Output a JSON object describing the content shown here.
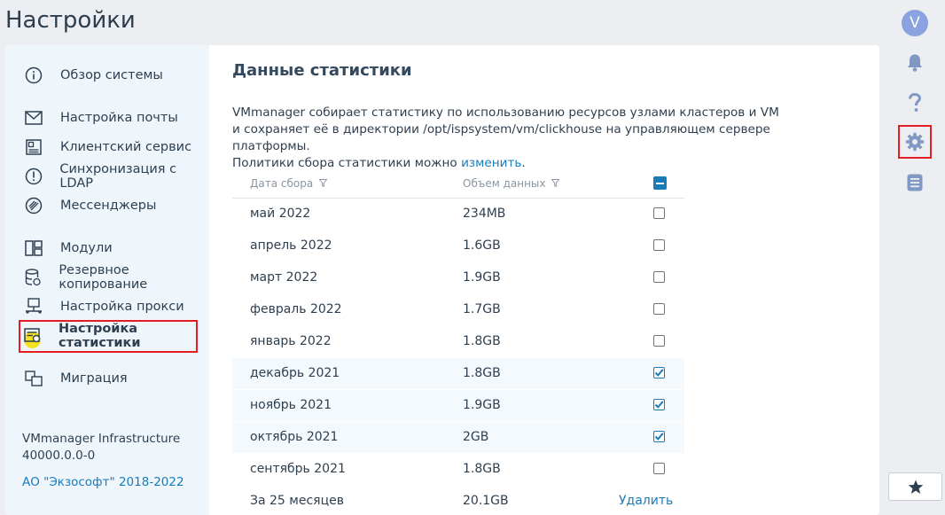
{
  "page": {
    "title": "Настройки"
  },
  "sidebar": {
    "items": [
      {
        "label": "Обзор системы"
      },
      {
        "label": "Настройка почты"
      },
      {
        "label": "Клиентский сервис"
      },
      {
        "label": "Синхронизация с LDAP"
      },
      {
        "label": "Мессенджеры"
      },
      {
        "label": "Модули"
      },
      {
        "label": "Резервное копирование"
      },
      {
        "label": "Настройка прокси"
      },
      {
        "label": "Настройка статистики",
        "active": true
      },
      {
        "label": "Миграция"
      }
    ],
    "product": "VMmanager Infrastructure",
    "version": "40000.0.0-0",
    "copyright": "АО \"Экзософт\" 2018-2022"
  },
  "main": {
    "title": "Данные статистики",
    "desc_line1": "VMmanager собирает статистику по использованию ресурсов узлами кластеров и VM",
    "desc_line2": "и сохраняет её в директории /opt/ispsystem/vm/clickhouse на управляющем сервере платформы.",
    "desc_line3": "Политики сбора статистики можно",
    "desc_link": "изменить",
    "desc_end": ".",
    "table": {
      "col_date": "Дата сбора",
      "col_size": "Объем данных",
      "rows": [
        {
          "date": "май 2022",
          "size": "234MB",
          "checked": false
        },
        {
          "date": "апрель 2022",
          "size": "1.6GB",
          "checked": false
        },
        {
          "date": "март 2022",
          "size": "1.9GB",
          "checked": false
        },
        {
          "date": "февраль 2022",
          "size": "1.7GB",
          "checked": false
        },
        {
          "date": "январь 2022",
          "size": "1.8GB",
          "checked": false
        },
        {
          "date": "декабрь 2021",
          "size": "1.8GB",
          "checked": true
        },
        {
          "date": "ноябрь 2021",
          "size": "1.9GB",
          "checked": true
        },
        {
          "date": "октябрь 2021",
          "size": "2GB",
          "checked": true
        },
        {
          "date": "сентябрь 2021",
          "size": "1.8GB",
          "checked": false
        }
      ],
      "footer_label": "За 25 месяцев",
      "footer_total": "20.1GB",
      "delete_label": "Удалить"
    }
  },
  "rightbar": {
    "avatar_letter": "V",
    "icons": [
      "bell-icon",
      "help-icon",
      "settings-icon",
      "list-icon",
      "star-icon"
    ]
  },
  "colors": {
    "accent": "#1a7bb9",
    "highlight": "#e51c23",
    "sidebar_bg": "#eef6fc"
  }
}
